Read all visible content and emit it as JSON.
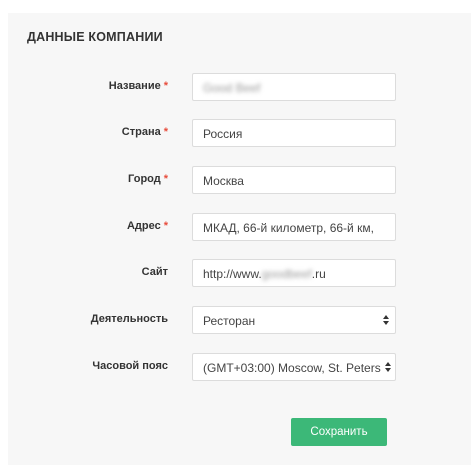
{
  "form": {
    "title": "ДАННЫЕ КОМПАНИИ",
    "required_marker": "*",
    "fields": [
      {
        "label": "Название",
        "value": "Good Beef"
      },
      {
        "label": "Страна",
        "value": "Россия"
      },
      {
        "label": "Город",
        "value": "Москва"
      },
      {
        "label": "Адрес",
        "value": "МКАД, 66-й километр, 66-й км,"
      },
      {
        "label": "Сайт",
        "value_prefix": "http://www.",
        "value_blurred": "goodbeef",
        "value_suffix": ".ru"
      },
      {
        "label": "Деятельность",
        "value": "Ресторан"
      },
      {
        "label": "Часовой пояс",
        "value": "(GMT+03:00) Moscow, St. Peters"
      }
    ],
    "save_label": "Сохранить"
  },
  "colors": {
    "accent": "#3cb878",
    "required": "#e74c3c",
    "panel_bg": "#f7f7f7"
  }
}
